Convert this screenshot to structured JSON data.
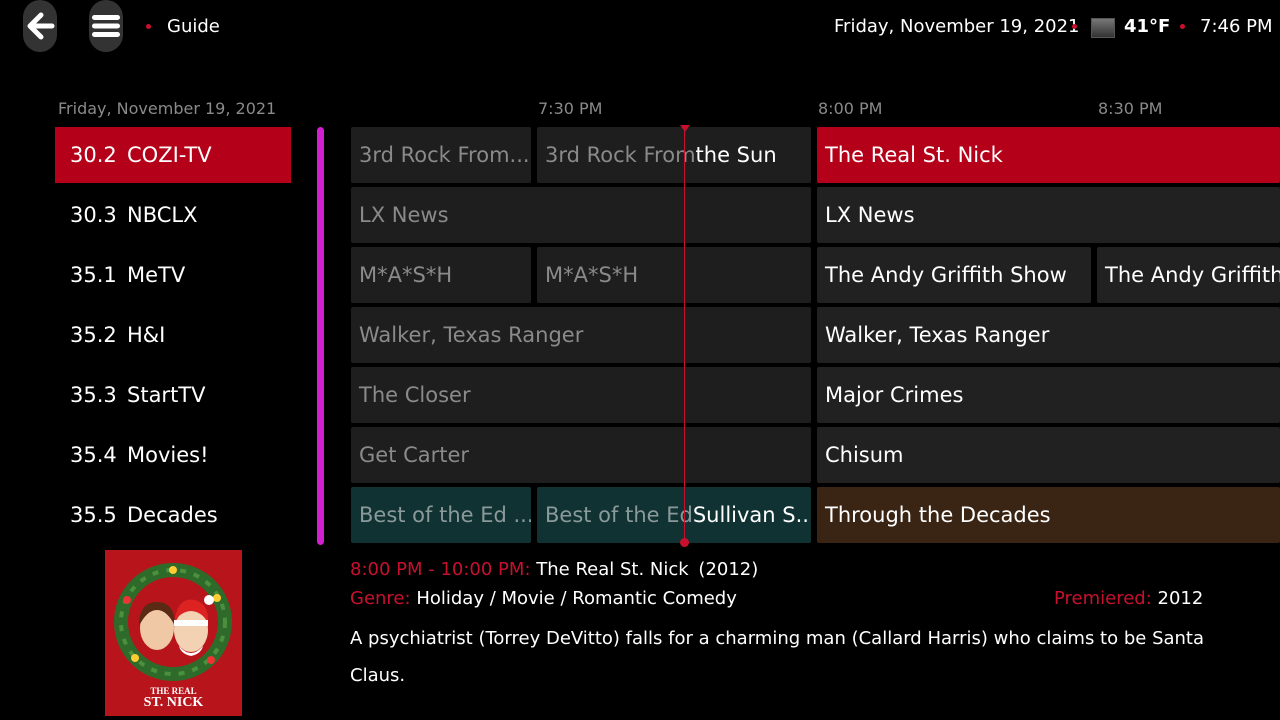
{
  "header": {
    "title": "Guide",
    "date": "Friday, November 19, 2021",
    "temperature": "41°F",
    "time": "7:46 PM",
    "weather_icon": "cloudy-icon"
  },
  "timeline": {
    "date": "Friday, November 19, 2021",
    "times": [
      "7:30 PM",
      "8:00 PM",
      "8:30 PM"
    ]
  },
  "channels": [
    {
      "number": "30.2",
      "name": "COZI-TV",
      "selected": true
    },
    {
      "number": "30.3",
      "name": "NBCLX"
    },
    {
      "number": "35.1",
      "name": "MeTV"
    },
    {
      "number": "35.2",
      "name": "H&I"
    },
    {
      "number": "35.3",
      "name": "StartTV"
    },
    {
      "number": "35.4",
      "name": "Movies!"
    },
    {
      "number": "35.5",
      "name": "Decades"
    }
  ],
  "grid": {
    "rows": [
      {
        "cells": [
          {
            "title": "3rd Rock From..."
          },
          {
            "title_past": "3rd Rock From",
            "title_now": " the Sun"
          },
          {
            "title": "The Real St. Nick"
          }
        ]
      },
      {
        "cells": [
          {
            "title": "LX News"
          },
          {
            "title": "LX News"
          }
        ]
      },
      {
        "cells": [
          {
            "title": "M*A*S*H"
          },
          {
            "title": "M*A*S*H"
          },
          {
            "title": "The Andy Griffith Show"
          },
          {
            "title": "The Andy Griffith S"
          }
        ]
      },
      {
        "cells": [
          {
            "title": "Walker, Texas Ranger"
          },
          {
            "title": "Walker, Texas Ranger"
          }
        ]
      },
      {
        "cells": [
          {
            "title": "The Closer"
          },
          {
            "title": "Major Crimes"
          }
        ]
      },
      {
        "cells": [
          {
            "title": "Get Carter"
          },
          {
            "title": "Chisum"
          }
        ]
      },
      {
        "cells": [
          {
            "title": "Best of the Ed ..."
          },
          {
            "title_past": "Best of the Ed",
            "title_now": " Sullivan S..."
          },
          {
            "title": "Through the Decades"
          }
        ]
      }
    ]
  },
  "details": {
    "time_range": "8:00 PM - 10:00 PM:",
    "title": "The Real St. Nick",
    "year": "(2012)",
    "genre_label": "Genre:",
    "genre": "Holiday / Movie / Romantic Comedy",
    "premiered_label": "Premiered:",
    "premiered": "2012",
    "description": "A psychiatrist (Torrey DeVitto) falls for a charming man (Callard Harris) who claims to be Santa Claus.",
    "poster_title_line1": "THE REAL",
    "poster_title_line2": "ST. NICK"
  },
  "colors": {
    "accent_red": "#c8102e",
    "selected_bg": "#b50019",
    "scrollbar": "#d020d0"
  }
}
